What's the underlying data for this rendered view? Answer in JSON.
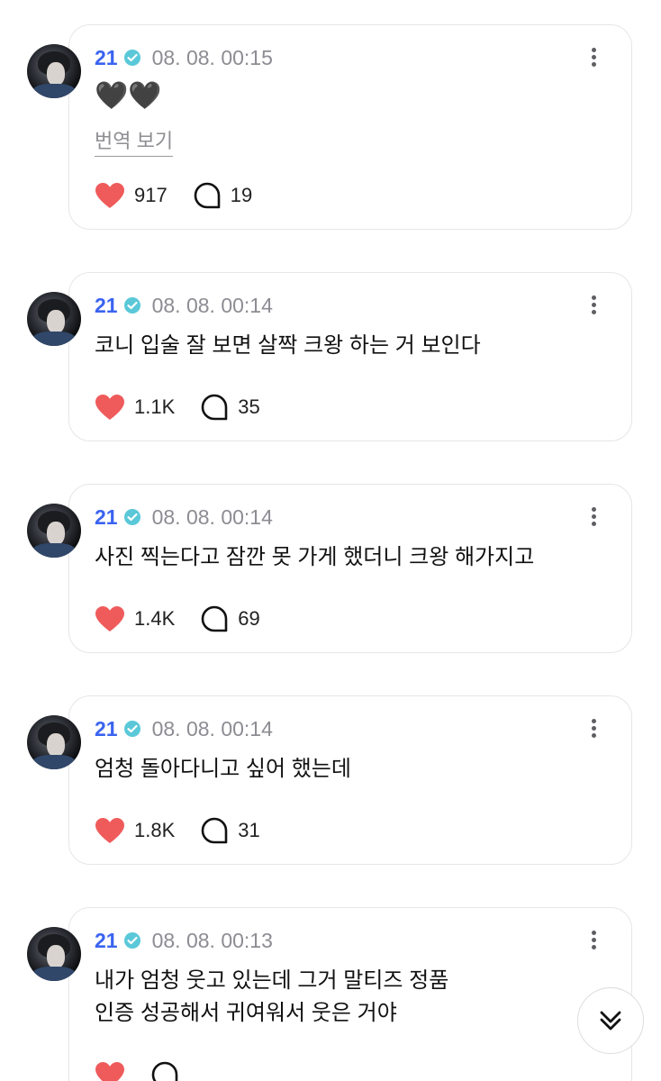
{
  "posts": [
    {
      "author": "21",
      "time": "08. 08. 00:15",
      "text": "🖤🖤",
      "translate_label": "번역 보기",
      "likes": "917",
      "comments": "19"
    },
    {
      "author": "21",
      "time": "08. 08. 00:14",
      "text": "코니 입술 잘 보면 살짝 크왕 하는 거 보인다",
      "likes": "1.1K",
      "comments": "35"
    },
    {
      "author": "21",
      "time": "08. 08. 00:14",
      "text": "사진 찍는다고 잠깐 못 가게 했더니 크왕 해가지고",
      "likes": "1.4K",
      "comments": "69"
    },
    {
      "author": "21",
      "time": "08. 08. 00:14",
      "text": "엄청 돌아다니고 싶어 했는데",
      "likes": "1.8K",
      "comments": "31"
    },
    {
      "author": "21",
      "time": "08. 08. 00:13",
      "text_lines": [
        "내가 엄청 웃고 있는데 그거 말티즈 정품",
        "인증 성공해서 귀여워서 웃은 거야"
      ]
    }
  ],
  "icons": {
    "like": "heart-icon",
    "comment": "comment-bubble-icon",
    "more": "more-vertical-icon",
    "verified": "verified-badge-icon",
    "scroll": "chevron-double-down-icon"
  },
  "colors": {
    "author": "#3a63f0",
    "verified": "#5ac8d8",
    "heart": "#ef5b5b",
    "timestamp": "#8c8c93"
  }
}
